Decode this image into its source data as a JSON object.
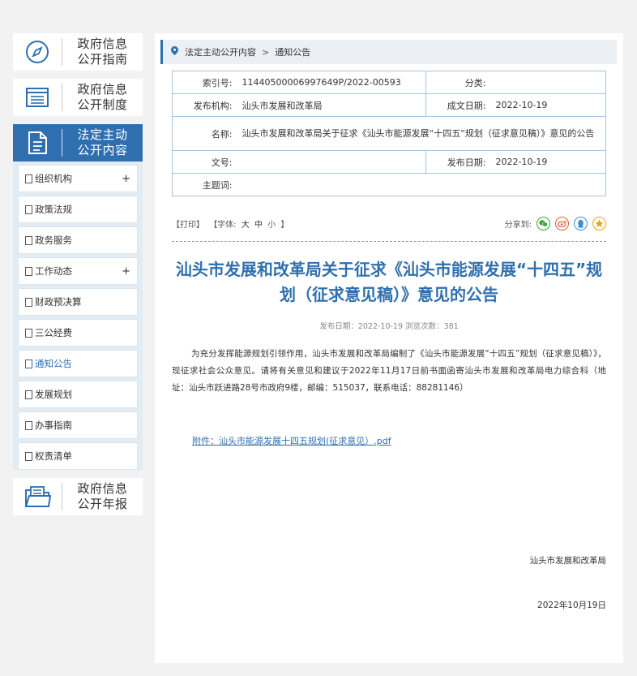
{
  "sidebar": {
    "guide": {
      "line1": "政府信息",
      "line2": "公开指南"
    },
    "system": {
      "line1": "政府信息",
      "line2": "公开制度"
    },
    "legal": {
      "line1": "法定主动",
      "line2": "公开内容"
    },
    "annual": {
      "line1": "政府信息",
      "line2": "公开年报"
    },
    "items": [
      {
        "label": "组织机构",
        "expand": "+"
      },
      {
        "label": "政策法规",
        "expand": ""
      },
      {
        "label": "政务服务",
        "expand": ""
      },
      {
        "label": "工作动态",
        "expand": "+"
      },
      {
        "label": "财政预决算",
        "expand": ""
      },
      {
        "label": "三公经费",
        "expand": ""
      },
      {
        "label": "通知公告",
        "expand": ""
      },
      {
        "label": "发展规划",
        "expand": ""
      },
      {
        "label": "办事指南",
        "expand": ""
      },
      {
        "label": "权责清单",
        "expand": ""
      }
    ]
  },
  "breadcrumb": {
    "level1": "法定主动公开内容",
    "sep": ">",
    "level2": "通知公告"
  },
  "meta": {
    "index_key": "索引号:",
    "index_val": "11440500006997649P/2022-00593",
    "class_key": "分类:",
    "class_val": "",
    "org_key": "发布机构:",
    "org_val": "汕头市发展和改革局",
    "made_key": "成文日期:",
    "made_val": "2022-10-19",
    "name_key": "名称:",
    "name_val": "汕头市发展和改革局关于征求《汕头市能源发展“十四五”规划（征求意见稿）》意见的公告",
    "docno_key": "文号:",
    "docno_val": "",
    "pub_key": "发布日期:",
    "pub_val": "2022-10-19",
    "subject_key": "主题词:",
    "subject_val": ""
  },
  "tools": {
    "print": "【打印】",
    "font_label": "【字体:",
    "font_big": "大",
    "font_mid": "中",
    "font_small": "小",
    "font_end": "】",
    "share": "分享到:"
  },
  "article": {
    "title": "汕头市发展和改革局关于征求《汕头市能源发展“十四五”规划（征求意见稿）》意见的公告",
    "pubinfo": "发布日期：2022-10-19  浏览次数：381",
    "body": "为充分发挥能源规划引领作用，汕头市发展和改革局编制了《汕头市能源发展“十四五”规划（征求意见稿）》，现征求社会公众意见。请将有关意见和建议于2022年11月17日前书面函寄汕头市发展和改革局电力综合科（地址：汕头市跃进路28号市政府9楼，邮编：515037，联系电话：88281146）",
    "attachment": "附件：汕头市能源发展十四五规划(征求意见）.pdf",
    "signature": "汕头市发展和改革局",
    "date": "2022年10月19日"
  }
}
